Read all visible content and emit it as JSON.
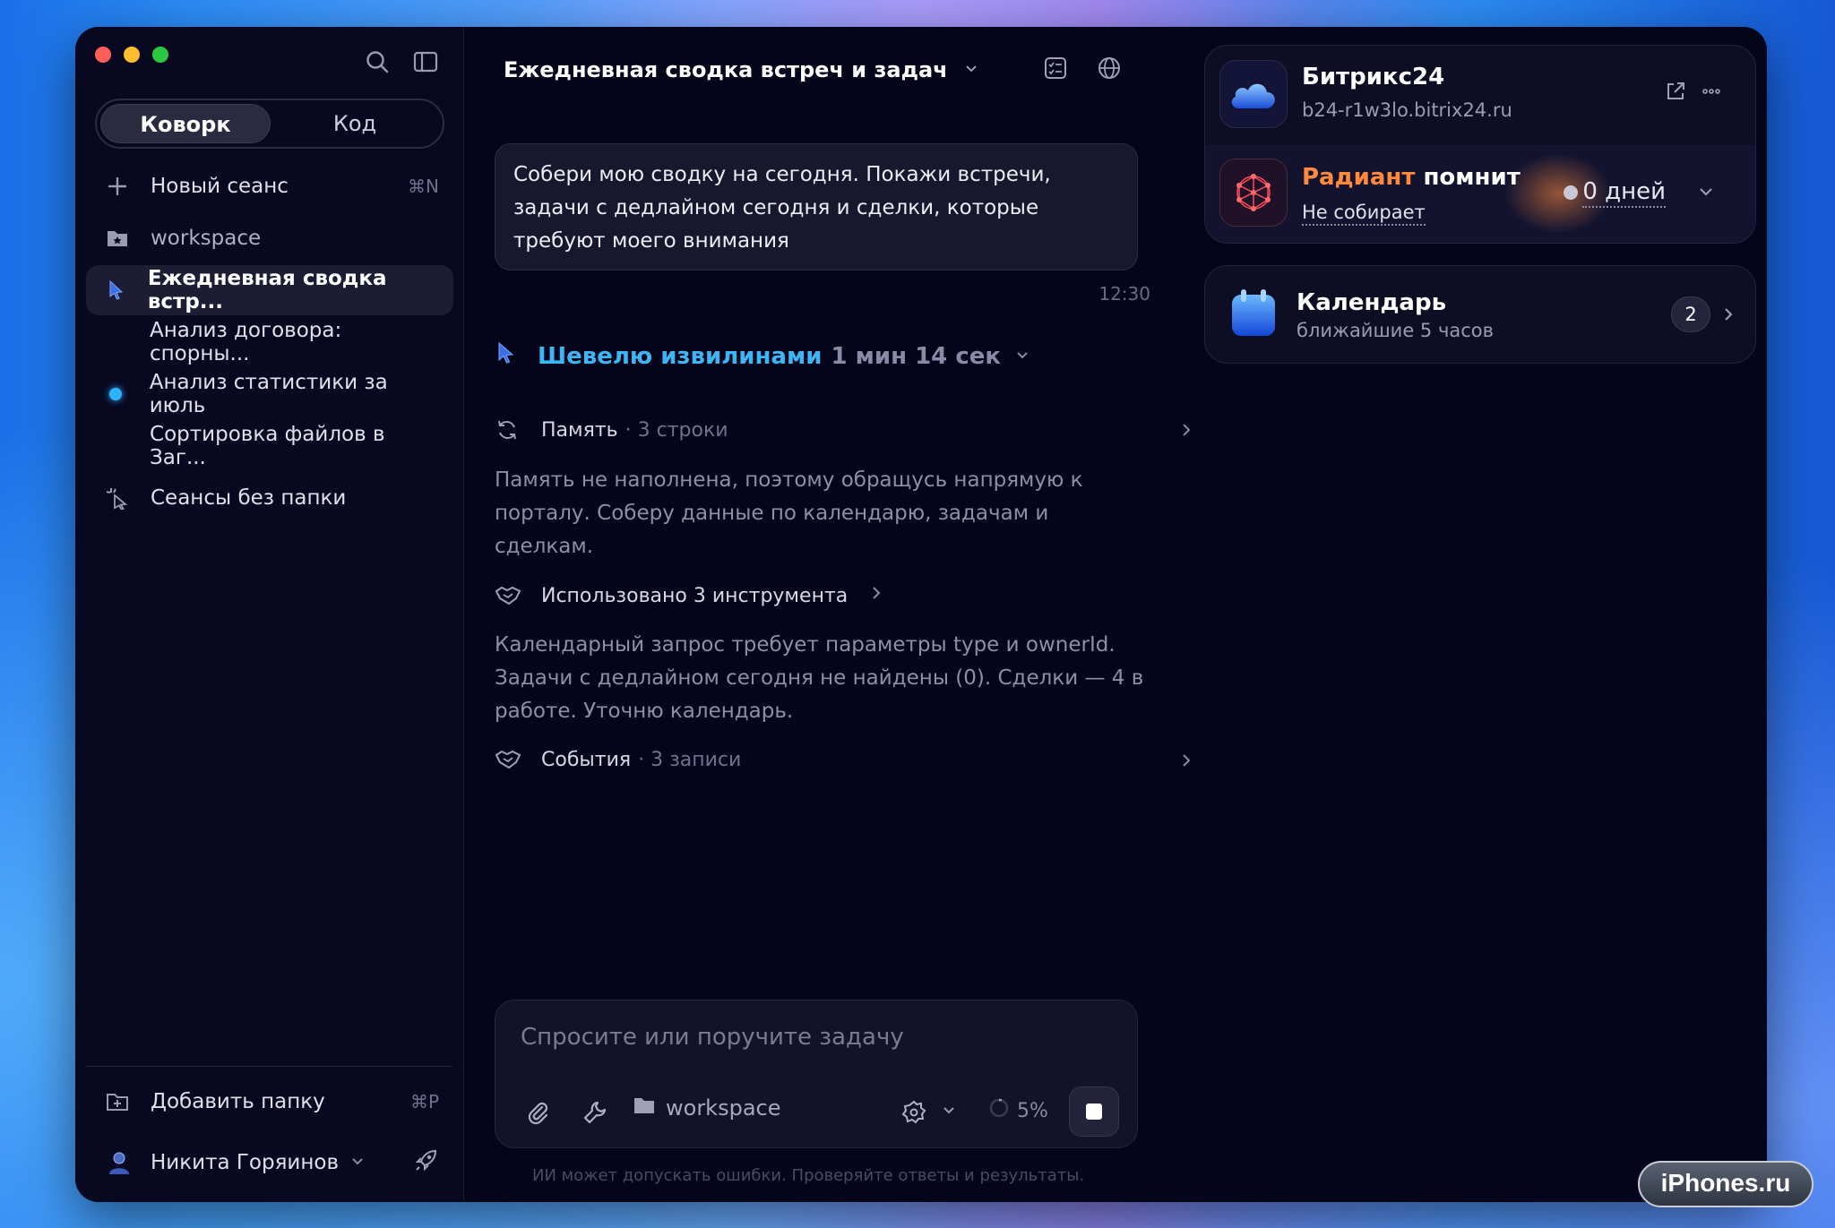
{
  "sidebar": {
    "segments": [
      "Коворк",
      "Код"
    ],
    "items": [
      {
        "label": "Новый сеанс",
        "shortcut": "⌘N"
      },
      {
        "label": "workspace"
      },
      {
        "label": "Ежедневная сводка встр..."
      },
      {
        "label": "Анализ договора: спорны..."
      },
      {
        "label": "Анализ статистики за июль"
      },
      {
        "label": "Сортировка файлов в Заг..."
      },
      {
        "label": "Сеансы без папки"
      }
    ],
    "add_folder": {
      "label": "Добавить папку",
      "shortcut": "⌘P"
    },
    "user": {
      "name": "Никита Горяинов"
    }
  },
  "main": {
    "title": "Ежедневная сводка встреч и задач",
    "user_message": "Собери мою сводку на сегодня. Покажи встречи, задачи с дедлайном сегодня и сделки, которые требуют моего внимания",
    "time": "12:30",
    "thinking_label": "Шевелю извилинами",
    "thinking_time": "1 мин 14 сек",
    "memory": {
      "label": "Память",
      "meta": "· 3 строки"
    },
    "para1": "Память не наполнена, поэтому обращусь напрямую к порталу. Соберу данные по календарю, задачам и сделкам.",
    "tools": {
      "label": "Использовано 3 инструмента"
    },
    "para2": "Календарный запрос требует параметры type и ownerId. Задачи с дедлайном сегодня не найдены (0). Сделки — 4 в работе. Уточню календарь.",
    "events": {
      "label": "События",
      "meta": "· 3 записи"
    },
    "composer": {
      "placeholder": "Спросите или поручите задачу",
      "workspace": "workspace",
      "percent": "5%"
    },
    "disclaimer": "ИИ может допускать ошибки. Проверяйте ответы и результаты."
  },
  "right": {
    "bitrix": {
      "title": "Битрикс24",
      "url": "b24-r1w3lo.bitrix24.ru"
    },
    "radiant": {
      "name_accent": "Радиант",
      "name_rest": " помнит",
      "status": "Не собирает",
      "days": "0 дней"
    },
    "calendar": {
      "title": "Календарь",
      "sub": "ближайшие 5 часов",
      "count": "2"
    }
  },
  "watermark": "iPhones.ru",
  "colors": {
    "accent_blue": "#3eb6f5",
    "accent_orange": "#ff8a3d",
    "window_bg": "#04041a"
  }
}
